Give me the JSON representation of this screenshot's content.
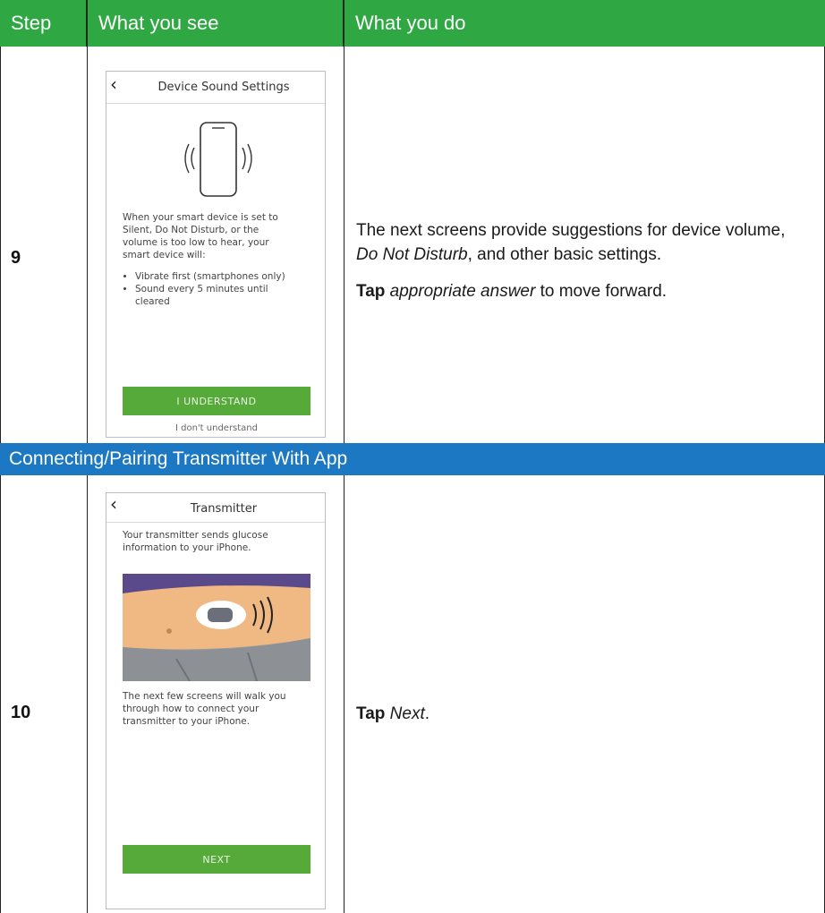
{
  "header": {
    "col_step": "Step",
    "col_see": "What you see",
    "col_do": "What you do"
  },
  "colors": {
    "header_green": "#2fa844",
    "section_blue": "#1d78c4",
    "button_green": "#55aa3a"
  },
  "rows": [
    {
      "step": "9",
      "phone": {
        "title": "Device Sound Settings",
        "icon": "phone-vibrate-icon",
        "body": "When your smart device is set to Silent, Do Not Disturb, or the volume is too low to hear, your smart device will:",
        "bullets": [
          "Vibrate first (smartphones only)",
          "Sound every 5 minutes until cleared"
        ],
        "button": "I UNDERSTAND",
        "link": "I don't understand"
      },
      "instructions": {
        "line1": "The next screens provide suggestions for device volume, ",
        "line1_em": "Do Not Disturb",
        "line1_end": ", and other basic settings.",
        "line2_strong": "Tap",
        "line2_em": "appropriate answer",
        "line2_end": " to move forward."
      }
    },
    {
      "step": "10",
      "phone": {
        "title": "Transmitter",
        "body1": "Your transmitter sends glucose information to your iPhone.",
        "image": "transmitter-on-abdomen-image",
        "body2": "The next few screens will walk you through how to connect your transmitter to your iPhone.",
        "button": "NEXT"
      },
      "instructions": {
        "strong": "Tap",
        "em": "Next",
        "end": "."
      }
    }
  ],
  "section": {
    "title": "Connecting/Pairing Transmitter With App"
  }
}
